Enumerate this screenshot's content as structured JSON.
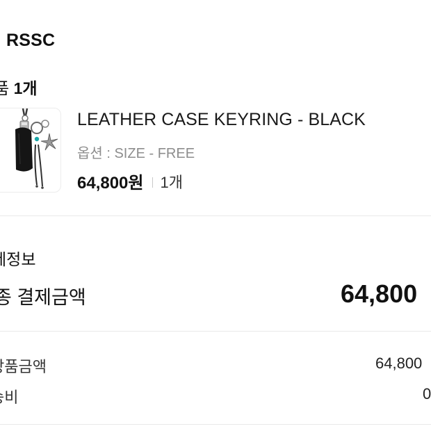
{
  "store": {
    "name": "RSSC"
  },
  "order": {
    "count_prefix": "품 ",
    "count_value": "1개"
  },
  "product": {
    "name": "LEATHER CASE KEYRING - BLACK",
    "option": "옵션 : SIZE - FREE",
    "price": "64,800원",
    "quantity": "1개",
    "thumbnail_icon": "leather-keyring-image"
  },
  "payment": {
    "section_title": "제정보",
    "total_label": "종 결제금액",
    "total_value": "64,800",
    "rows": [
      {
        "label": "상품금액",
        "value": "64,800"
      },
      {
        "label": "송비",
        "value": "0"
      }
    ]
  }
}
